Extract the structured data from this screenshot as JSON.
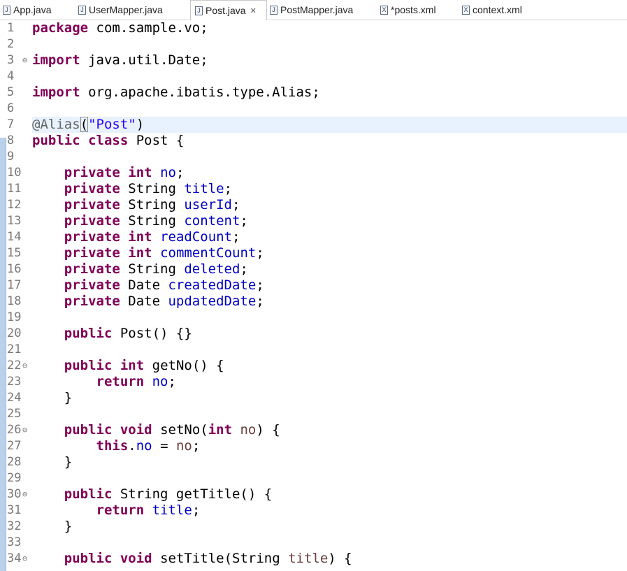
{
  "tabs": [
    {
      "label": "App.java",
      "icon": "java-file-icon",
      "active": false
    },
    {
      "label": "UserMapper.java",
      "icon": "java-file-icon",
      "active": false
    },
    {
      "label": "Post.java",
      "icon": "java-file-icon",
      "active": true
    },
    {
      "label": "PostMapper.java",
      "icon": "java-file-icon",
      "active": false
    },
    {
      "label": "*posts.xml",
      "icon": "xml-file-icon",
      "active": false
    },
    {
      "label": "context.xml",
      "icon": "xml-file-icon",
      "active": false
    }
  ],
  "active_tab_close_glyph": "✕",
  "line_numbers": [
    "1",
    "2",
    "3",
    "4",
    "5",
    "6",
    "7",
    "8",
    "9",
    "10",
    "11",
    "12",
    "13",
    "14",
    "15",
    "16",
    "17",
    "18",
    "19",
    "20",
    "21",
    "22",
    "23",
    "24",
    "25",
    "26",
    "27",
    "28",
    "29",
    "30",
    "31",
    "32",
    "33",
    "34"
  ],
  "fold_markers": {
    "3": "⊖",
    "22": "⊖",
    "26": "⊖",
    "30": "⊖",
    "34": "⊖"
  },
  "highlighted_line": 7,
  "colors": {
    "keyword": "#7f0055",
    "field": "#0000c0",
    "string": "#2a00ff",
    "annotation": "#646464",
    "parameter": "#6a3e3e",
    "current_line": "#e8f2fe",
    "ruler": "#b9d1ea"
  },
  "code_lines": [
    [
      {
        "t": "package",
        "s": "kw"
      },
      {
        "t": " com.sample.vo;"
      }
    ],
    [],
    [
      {
        "t": "import",
        "s": "kw"
      },
      {
        "t": " java.util.Date;"
      }
    ],
    [],
    [
      {
        "t": "import",
        "s": "kw"
      },
      {
        "t": " org.apache.ibatis.type.Alias;"
      }
    ],
    [],
    [
      {
        "t": "@Alias",
        "s": "ann"
      },
      {
        "t": "(",
        "s": "bracket"
      },
      {
        "t": "\"Post\"",
        "s": "str"
      },
      {
        "t": ")"
      }
    ],
    [
      {
        "t": "public",
        "s": "kw"
      },
      {
        "t": " "
      },
      {
        "t": "class",
        "s": "kw"
      },
      {
        "t": " Post {"
      }
    ],
    [],
    [
      {
        "t": "    "
      },
      {
        "t": "private",
        "s": "kw"
      },
      {
        "t": " "
      },
      {
        "t": "int",
        "s": "kw"
      },
      {
        "t": " "
      },
      {
        "t": "no",
        "s": "fld"
      },
      {
        "t": ";"
      }
    ],
    [
      {
        "t": "    "
      },
      {
        "t": "private",
        "s": "kw"
      },
      {
        "t": " String "
      },
      {
        "t": "title",
        "s": "fld"
      },
      {
        "t": ";"
      }
    ],
    [
      {
        "t": "    "
      },
      {
        "t": "private",
        "s": "kw"
      },
      {
        "t": " String "
      },
      {
        "t": "userId",
        "s": "fld"
      },
      {
        "t": ";"
      }
    ],
    [
      {
        "t": "    "
      },
      {
        "t": "private",
        "s": "kw"
      },
      {
        "t": " String "
      },
      {
        "t": "content",
        "s": "fld"
      },
      {
        "t": ";"
      }
    ],
    [
      {
        "t": "    "
      },
      {
        "t": "private",
        "s": "kw"
      },
      {
        "t": " "
      },
      {
        "t": "int",
        "s": "kw"
      },
      {
        "t": " "
      },
      {
        "t": "readCount",
        "s": "fld"
      },
      {
        "t": ";"
      }
    ],
    [
      {
        "t": "    "
      },
      {
        "t": "private",
        "s": "kw"
      },
      {
        "t": " "
      },
      {
        "t": "int",
        "s": "kw"
      },
      {
        "t": " "
      },
      {
        "t": "commentCount",
        "s": "fld"
      },
      {
        "t": ";"
      }
    ],
    [
      {
        "t": "    "
      },
      {
        "t": "private",
        "s": "kw"
      },
      {
        "t": " String "
      },
      {
        "t": "deleted",
        "s": "fld"
      },
      {
        "t": ";"
      }
    ],
    [
      {
        "t": "    "
      },
      {
        "t": "private",
        "s": "kw"
      },
      {
        "t": " Date "
      },
      {
        "t": "createdDate",
        "s": "fld"
      },
      {
        "t": ";"
      }
    ],
    [
      {
        "t": "    "
      },
      {
        "t": "private",
        "s": "kw"
      },
      {
        "t": " Date "
      },
      {
        "t": "updatedDate",
        "s": "fld"
      },
      {
        "t": ";"
      }
    ],
    [],
    [
      {
        "t": "    "
      },
      {
        "t": "public",
        "s": "kw"
      },
      {
        "t": " Post() {}"
      }
    ],
    [],
    [
      {
        "t": "    "
      },
      {
        "t": "public",
        "s": "kw"
      },
      {
        "t": " "
      },
      {
        "t": "int",
        "s": "kw"
      },
      {
        "t": " getNo() {"
      }
    ],
    [
      {
        "t": "        "
      },
      {
        "t": "return",
        "s": "kw"
      },
      {
        "t": " "
      },
      {
        "t": "no",
        "s": "fld"
      },
      {
        "t": ";"
      }
    ],
    [
      {
        "t": "    }"
      }
    ],
    [],
    [
      {
        "t": "    "
      },
      {
        "t": "public",
        "s": "kw"
      },
      {
        "t": " "
      },
      {
        "t": "void",
        "s": "kw"
      },
      {
        "t": " setNo("
      },
      {
        "t": "int",
        "s": "kw"
      },
      {
        "t": " "
      },
      {
        "t": "no",
        "s": "par"
      },
      {
        "t": ") {"
      }
    ],
    [
      {
        "t": "        "
      },
      {
        "t": "this",
        "s": "kw"
      },
      {
        "t": "."
      },
      {
        "t": "no",
        "s": "fld"
      },
      {
        "t": " = "
      },
      {
        "t": "no",
        "s": "par"
      },
      {
        "t": ";"
      }
    ],
    [
      {
        "t": "    }"
      }
    ],
    [],
    [
      {
        "t": "    "
      },
      {
        "t": "public",
        "s": "kw"
      },
      {
        "t": " String getTitle() {"
      }
    ],
    [
      {
        "t": "        "
      },
      {
        "t": "return",
        "s": "kw"
      },
      {
        "t": " "
      },
      {
        "t": "title",
        "s": "fld"
      },
      {
        "t": ";"
      }
    ],
    [
      {
        "t": "    }"
      }
    ],
    [],
    [
      {
        "t": "    "
      },
      {
        "t": "public",
        "s": "kw"
      },
      {
        "t": " "
      },
      {
        "t": "void",
        "s": "kw"
      },
      {
        "t": " setTitle(String "
      },
      {
        "t": "title",
        "s": "par"
      },
      {
        "t": ") {"
      }
    ]
  ]
}
